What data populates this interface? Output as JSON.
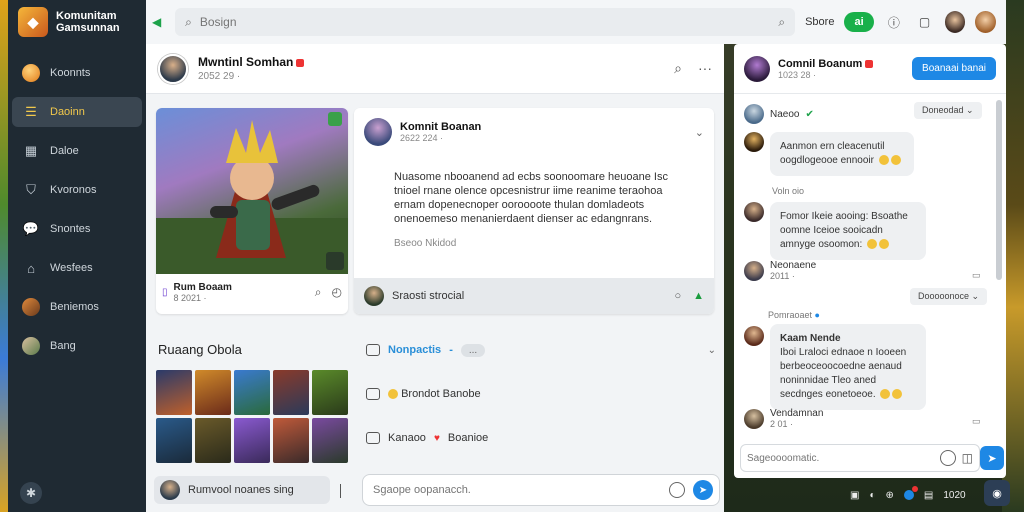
{
  "app": {
    "brand_line1": "Komunitam",
    "brand_line2": "Gamsunnan"
  },
  "sidebar": {
    "items": [
      {
        "label": "Koonnts",
        "icon": "coin-icon"
      },
      {
        "label": "Daoinn",
        "icon": "list-icon",
        "active": true
      },
      {
        "label": "Daloe",
        "icon": "store-icon"
      },
      {
        "label": "Kvoronos",
        "icon": "shield-icon"
      },
      {
        "label": "Snontes",
        "icon": "chat-icon"
      },
      {
        "label": "Wesfees",
        "icon": "controller-icon"
      },
      {
        "label": "Beniemos",
        "icon": "avatar-icon"
      },
      {
        "label": "Bang",
        "icon": "avatar-icon"
      }
    ]
  },
  "topbar": {
    "search_placeholder": "Bosign",
    "store_label": "Sbore",
    "green_pill": "ai"
  },
  "post": {
    "author": "Mwntinl Somhan",
    "meta": "2052 29 ·"
  },
  "hero_card": {
    "name": "Rum Boaam",
    "meta": "8 2021 ·"
  },
  "detail_card": {
    "author": "Komnit Boanan",
    "meta": "2622 224 ·",
    "body": "Nuasome nbooanend ad ecbs soonoomare heuoane Isc tnioel rnane olence opcesnistrur iime reanime teraohoa ernam dopenecnoper ooroooote thulan domladeots onenoemeso menanierdaent dienser ac edangnrans.",
    "more": "Bseoo Nkidod",
    "footer_label": "Sraosti strocial"
  },
  "gallery": {
    "title": "Ruaang Obola"
  },
  "threads": [
    {
      "label": "Nonpactis",
      "kind": "blue",
      "extra": "..."
    },
    {
      "label": "Brondot Banobe",
      "kind": "emoji"
    },
    {
      "label": "Kanaoo",
      "extra_label": "Boanioe",
      "kind": "heart"
    }
  ],
  "composer": {
    "left_label": "Rumvool noanes sing",
    "right_placeholder": "Sgaope oopanacch."
  },
  "chat": {
    "title": "Comnil Boanum",
    "meta": "1023 28 ·",
    "button_label": "Boanaai banai",
    "messages": {
      "m1_name": "Naeoo",
      "m1_tag": "Doneodad",
      "m2_text": "Aanmon ern cleacenutil oogdlogeooe ennooir",
      "m2_meta": "Voln oio",
      "m3_text": "Fomor Ikeie aooing: Bsoathe oomne Iceioe sooicadn amnyge osoomon:",
      "m4_name": "Neonaene",
      "m4_meta": "2011 ·",
      "m5_tag": "Dooooonoce",
      "m5_name": "Pomraoaet",
      "m6_name": "Kaam Nende",
      "m6_text": "Iboi Lraloci ednaoe n Iooeen berbeoceoocoedne aenaud noninnidae Tleo aned secdnges eonetoeoe.",
      "m7_name": "Vendamnan",
      "m7_meta": "2 01 ·"
    },
    "input_placeholder": "Sageoooomatic."
  },
  "tray": {
    "time": "1020"
  }
}
